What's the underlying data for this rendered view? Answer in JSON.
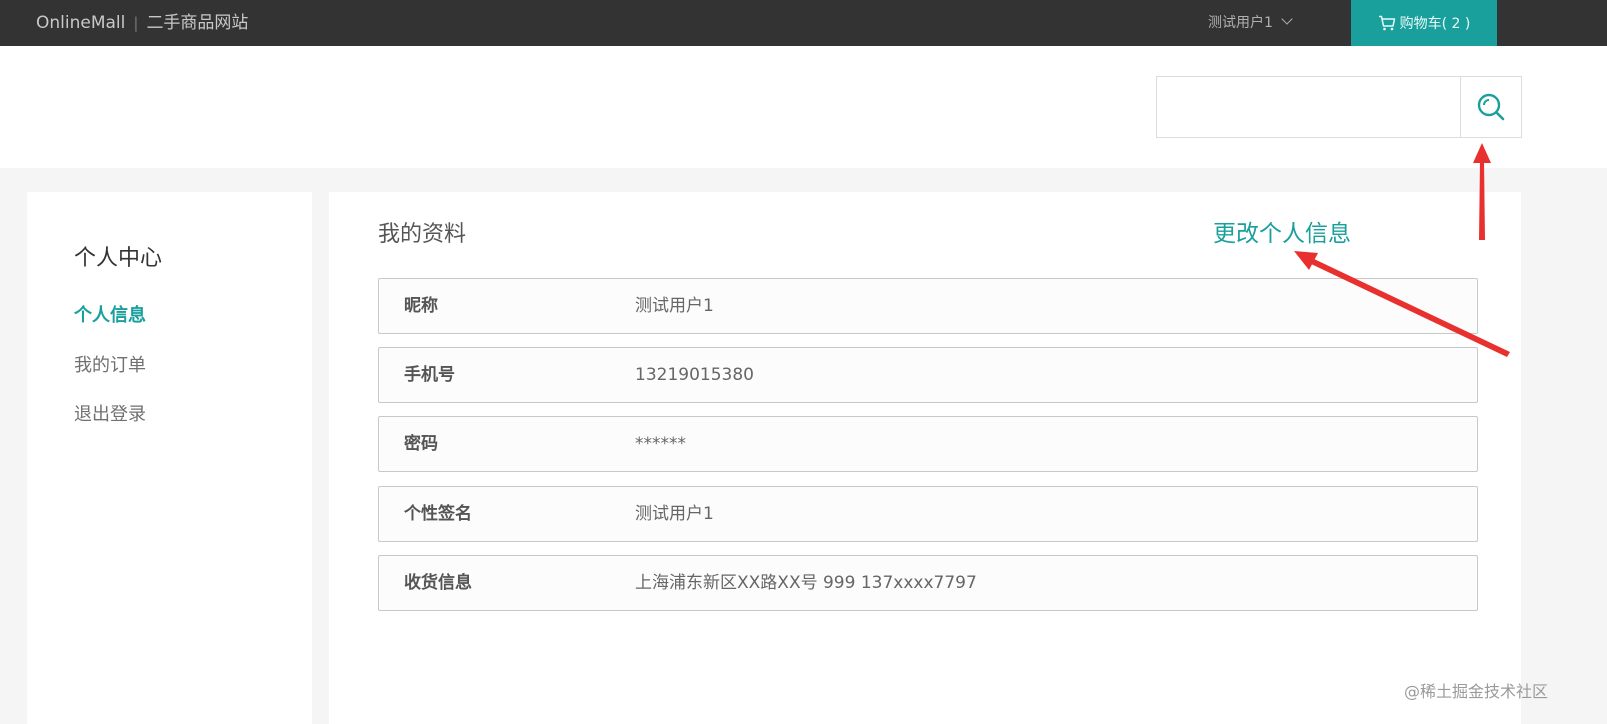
{
  "topbar": {
    "brand_name": "OnlineMall",
    "brand_separator": "|",
    "brand_subtitle": "二手商品网站",
    "user_name": "测试用户1",
    "cart_label": "购物车( 2 )"
  },
  "search": {
    "placeholder": "",
    "value": ""
  },
  "sidebar": {
    "title": "个人中心",
    "items": [
      {
        "label": "个人信息"
      },
      {
        "label": "我的订单"
      },
      {
        "label": "退出登录"
      }
    ]
  },
  "main": {
    "title": "我的资料",
    "edit_link": "更改个人信息",
    "fields": [
      {
        "label": "昵称",
        "value": "测试用户1"
      },
      {
        "label": "手机号",
        "value": "13219015380"
      },
      {
        "label": "密码",
        "value": "******"
      },
      {
        "label": "个性签名",
        "value": "测试用户1"
      },
      {
        "label": "收货信息",
        "value": "上海浦东新区XX路XX号 999 137xxxx7797"
      }
    ]
  },
  "watermark": "@稀土掘金技术社区",
  "colors": {
    "accent": "#1aa09c",
    "topbar": "#333333",
    "annotation_arrow": "#e8312f"
  },
  "icons": {
    "cart": "cart-icon",
    "search": "search-icon",
    "dropdown": "chevron-down-icon"
  }
}
